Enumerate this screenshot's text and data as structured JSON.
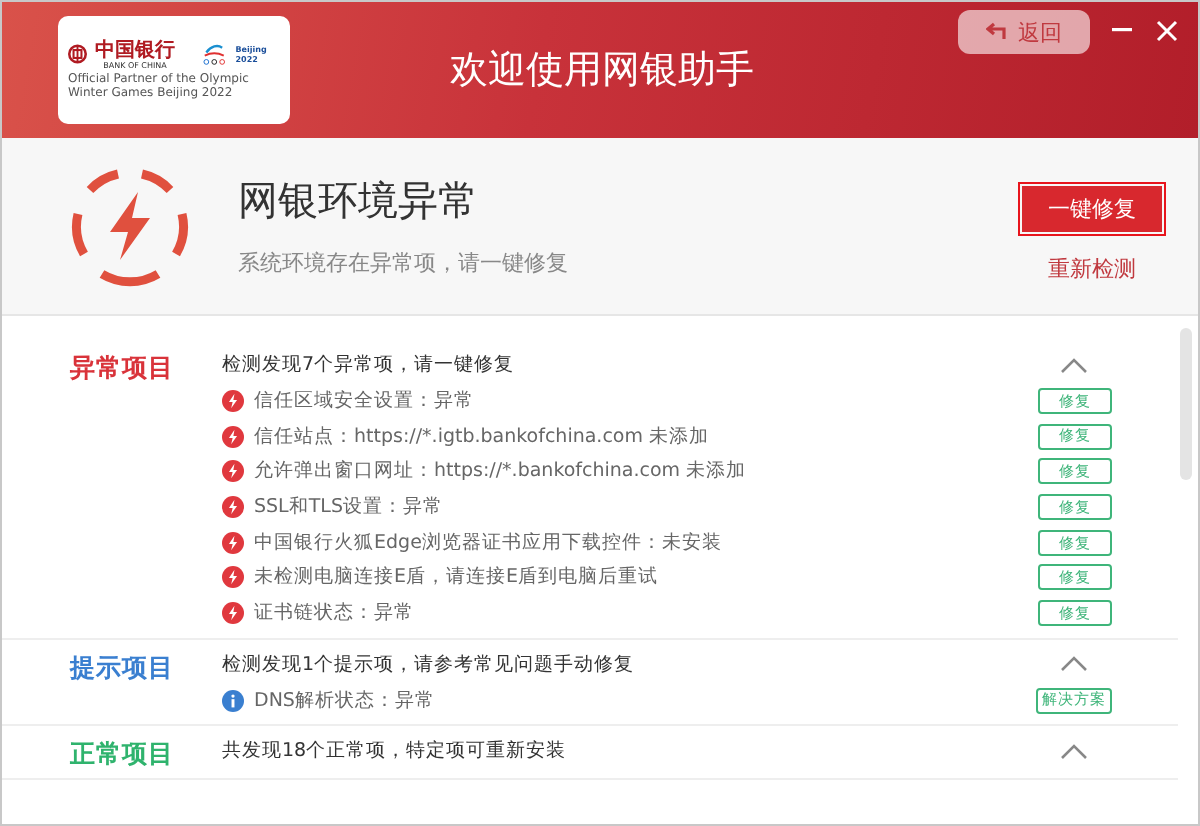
{
  "window": {
    "title": "欢迎使用网银助手",
    "back_label": "返回"
  },
  "logo": {
    "bank_cn": "中国银行",
    "bank_en": "BANK OF CHINA",
    "games": "Beijing 2022",
    "partner": "Official Partner of the Olympic Winter Games Beijing 2022"
  },
  "status": {
    "title": "网银环境异常",
    "subtitle": "系统环境存在异常项，请一键修复",
    "fix_all": "一键修复",
    "recheck": "重新检测"
  },
  "sections": [
    {
      "kind": "anomaly",
      "label": "异常项目",
      "summary": "检测发现7个异常项，请一键修复",
      "expanded": true,
      "items": [
        {
          "text": "信任区域安全设置：异常",
          "action": "修复"
        },
        {
          "text": "信任站点：https://*.igtb.bankofchina.com 未添加",
          "action": "修复"
        },
        {
          "text": "允许弹出窗口网址：https://*.bankofchina.com 未添加",
          "action": "修复"
        },
        {
          "text": "SSL和TLS设置：异常",
          "action": "修复"
        },
        {
          "text": "中国银行火狐Edge浏览器证书应用下载控件：未安装",
          "action": "修复"
        },
        {
          "text": "未检测电脑连接E盾，请连接E盾到电脑后重试",
          "action": "修复"
        },
        {
          "text": "证书链状态：异常",
          "action": "修复"
        }
      ]
    },
    {
      "kind": "hint",
      "label": "提示项目",
      "summary": "检测发现1个提示项，请参考常见问题手动修复",
      "expanded": true,
      "items": [
        {
          "text": "DNS解析状态：异常",
          "action": "解决方案"
        }
      ]
    },
    {
      "kind": "normal",
      "label": "正常项目",
      "summary": "共发现18个正常项，特定项可重新安装",
      "expanded": true
    }
  ]
}
